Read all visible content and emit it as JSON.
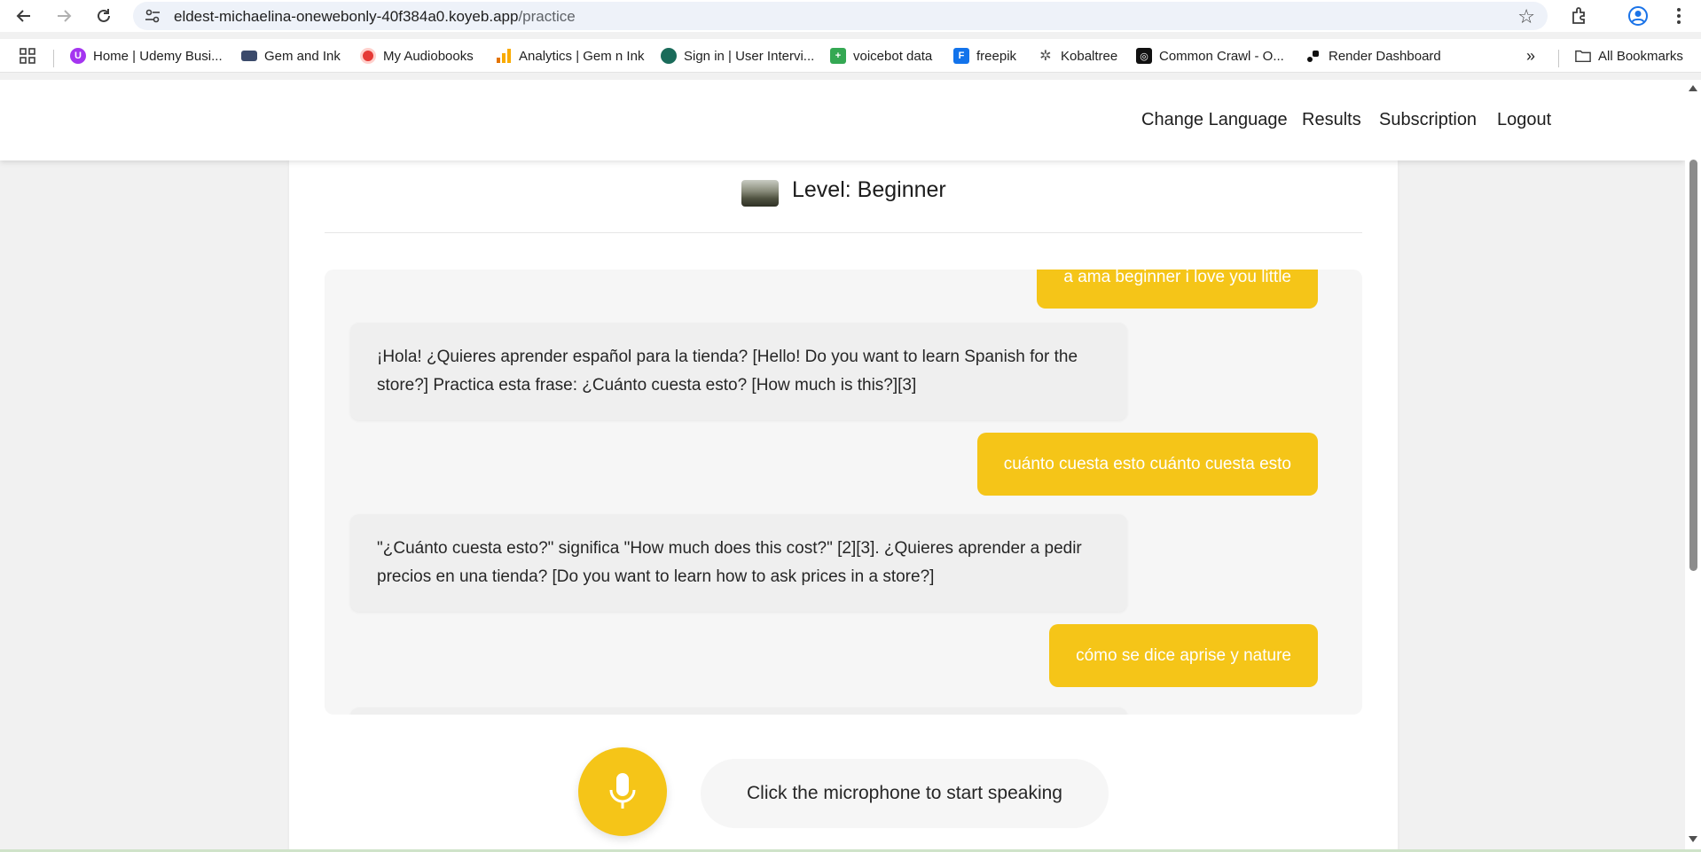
{
  "browser": {
    "url_host": "eldest-michaelina-onewebonly-40f384a0.koyeb.app",
    "url_path": "/practice",
    "bookmarks": [
      {
        "label": "Home | Udemy Busi...",
        "color": "#a435f0",
        "icon": "udemy-icon"
      },
      {
        "label": "Gem and Ink",
        "color": "#3b4a6b",
        "icon": "gem-ink-icon"
      },
      {
        "label": "My Audiobooks",
        "color": "#e53935",
        "icon": "audiobooks-icon"
      },
      {
        "label": "Analytics | Gem n Ink",
        "color": "#f9ab00",
        "icon": "analytics-icon"
      },
      {
        "label": "Sign in | User Intervi...",
        "color": "#1a6b5a",
        "icon": "user-interviews-icon"
      },
      {
        "label": "voicebot data",
        "color": "#34a853",
        "icon": "sheets-icon"
      },
      {
        "label": "freepik",
        "color": "#1273eb",
        "icon": "freepik-icon"
      },
      {
        "label": "Kobaltree",
        "color": "#555555",
        "icon": "kobaltree-icon"
      },
      {
        "label": "Common Crawl - O...",
        "color": "#111111",
        "icon": "common-crawl-icon"
      },
      {
        "label": "Render Dashboard",
        "color": "#111111",
        "icon": "render-icon"
      }
    ],
    "all_bookmarks": "All Bookmarks",
    "overflow": "»"
  },
  "nav": {
    "change_language": "Change Language",
    "results": "Results",
    "subscription": "Subscription",
    "logout": "Logout"
  },
  "level": {
    "title": "Level: Beginner"
  },
  "chat": {
    "messages": [
      {
        "role": "user",
        "text": "a ama beginner i love you little"
      },
      {
        "role": "bot",
        "text": "¡Hola! ¿Quieres aprender español para la tienda? [Hello! Do you want to learn Spanish for the store?] Practica esta frase: ¿Cuánto cuesta esto? [How much is this?][3]"
      },
      {
        "role": "user",
        "text": "cuánto cuesta esto cuánto cuesta esto"
      },
      {
        "role": "bot",
        "text": "\"¿Cuánto cuesta esto?\" significa \"How much does this cost?\" [2][3]. ¿Quieres aprender a pedir precios en una tienda? [Do you want to learn how to ask prices in a store?]"
      },
      {
        "role": "user",
        "text": "cómo se dice aprise y nature"
      }
    ]
  },
  "speech": {
    "prompt": "Click the microphone to start speaking"
  },
  "colors": {
    "accent": "#f5c518",
    "bot_bubble": "#efefef"
  }
}
